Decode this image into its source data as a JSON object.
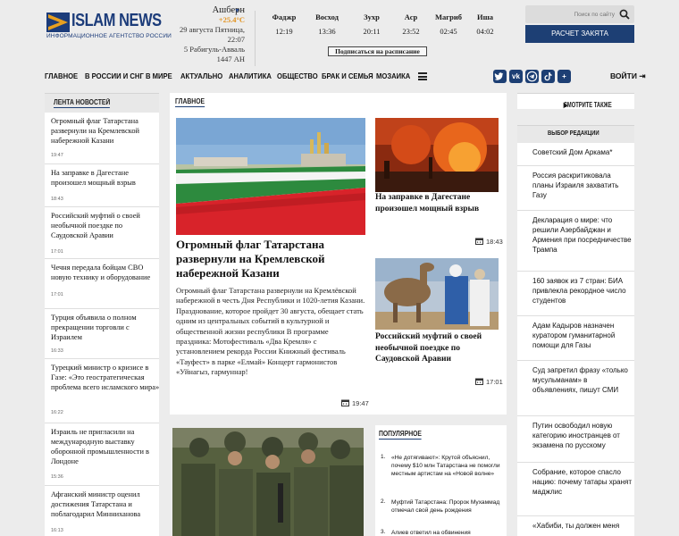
{
  "logo": {
    "name": "ISLAM NEWS",
    "tagline": "ИНФОРМАЦИОННОЕ АГЕНТСТВО РОССИИ"
  },
  "weather": {
    "city": "Ашберн",
    "temperature": "+25.4°C",
    "date_line": "29 августа Пятница, 22:07",
    "hijri_line": "5 Рабигуль-Авваль 1447 АН"
  },
  "prayers": [
    {
      "name": "Фаджр",
      "time": "12:19"
    },
    {
      "name": "Восход",
      "time": "13:36"
    },
    {
      "name": "Зухр",
      "time": "20:11"
    },
    {
      "name": "Аср",
      "time": "23:52"
    },
    {
      "name": "Магриб",
      "time": "02:45"
    },
    {
      "name": "Иша",
      "time": "04:02"
    }
  ],
  "subscribe_label": "Подписаться на расписание",
  "search": {
    "placeholder": "Поиск по сайту"
  },
  "zakat_label": "РАСЧЕТ ЗАКЯТА",
  "nav": {
    "items": [
      "ГЛАВНОЕ",
      "В РОССИИ И СНГ",
      "В МИРЕ",
      "АКТУАЛЬНО",
      "АНАЛИТИКА",
      "ОБЩЕСТВО",
      "БРАК И СЕМЬЯ",
      "МОЗАИКА"
    ],
    "social": [
      "twitter",
      "vk",
      "telegram",
      "tiktok",
      "more"
    ],
    "login_label": "ВОЙТИ"
  },
  "feed": {
    "title": "ЛЕНТА НОВОСТЕЙ",
    "items": [
      {
        "title": "Огромный флаг Татарстана развернули на Кремлевской набережной Казани",
        "time": "19:47"
      },
      {
        "title": "На заправке в Дагестане произошел мощный взрыв",
        "time": "18:43"
      },
      {
        "title": "Российский муфтий о своей необычной поездке по Саудовской Аравии",
        "time": "17:01"
      },
      {
        "title": "Чечня передала бойцам СВО новую технику и оборудование",
        "time": "17:01"
      },
      {
        "title": "Турция объявила о полном прекращении торговли с Израилем",
        "time": "16:33"
      },
      {
        "title": "Турецкий министр о кризисе в Газе: «Это геостратегическая проблема всего исламского мира»",
        "time": "16:22"
      },
      {
        "title": "Израиль не пригласили на международную выставку оборонной промышленности в Лондоне",
        "time": "15:36"
      },
      {
        "title": "Афганский министр оценил достижения Татарстана и поблагодарил Минниханова",
        "time": "16:13"
      }
    ]
  },
  "main": {
    "title": "ГЛАВНОЕ",
    "lead": {
      "headline": "Огромный флаг Татарстана развернули на Кремлевской набережной Казани",
      "text": "Огромный флаг Татарстана развернули на Кремлёвской набережной в честь Дня Республики и 1020-летия Казани. Празднование, которое пройдет 30 августа, обещает стать одним из центральных событий в культурной и общественной жизни республики В программе праздника: Мотофестиваль «Два Кремля» с установлением рекорда России Книжный фестиваль «Тауфест» в парке «Елмай» Концерт гармонистов «Уйнагыз, гармуннар!",
      "time": "19:47"
    },
    "side": [
      {
        "headline": "На заправке в Дагестане произошел мощный взрыв",
        "time": "18:43"
      },
      {
        "headline": "Российский муфтий о своей необычной поездке по Саудовской Аравии",
        "time": "17:01"
      }
    ]
  },
  "popular": {
    "title": "ПОПУЛЯРНОЕ",
    "items": [
      {
        "num": "1.",
        "text": "«Не дотягивают»: Крутой объяснил, почему $10 млн Татарстана не помогли местным артистам на «Новой волне»"
      },
      {
        "num": "2.",
        "text": "Муфтий Татарстана: Пророк Мухаммад отмечал свой день рождения"
      },
      {
        "num": "3.",
        "text": "Алиев ответил на обвинения"
      }
    ]
  },
  "see_also_label": "СМОТРИТЕ ТАКЖЕ",
  "editor": {
    "title": "ВЫБОР РЕДАКЦИИ",
    "items": [
      "Советский Дом Аркама*",
      "Россия раскритиковала планы Израиля захватить Газу",
      "Декларация о мире: что решили Азербайджан и Армения при посредничестве Трампа",
      "160 заявок из 7 стран: БИА привлекла рекордное число студентов",
      "Адам Кадыров назначен куратором гуманитарной помощи для Газы",
      "Суд запретил фразу «только мусульманам» в объявлениях, пишут СМИ",
      "Путин освободил новую категорию иностранцев от экзамена по русскому",
      "Собрание, которое спасло нацию: почему татары хранят маджлис",
      "«Хабиби, ты должен меня"
    ]
  },
  "colors": {
    "brand": "#1d3f74",
    "accent_temp": "#e29320",
    "background": "#ececec"
  }
}
